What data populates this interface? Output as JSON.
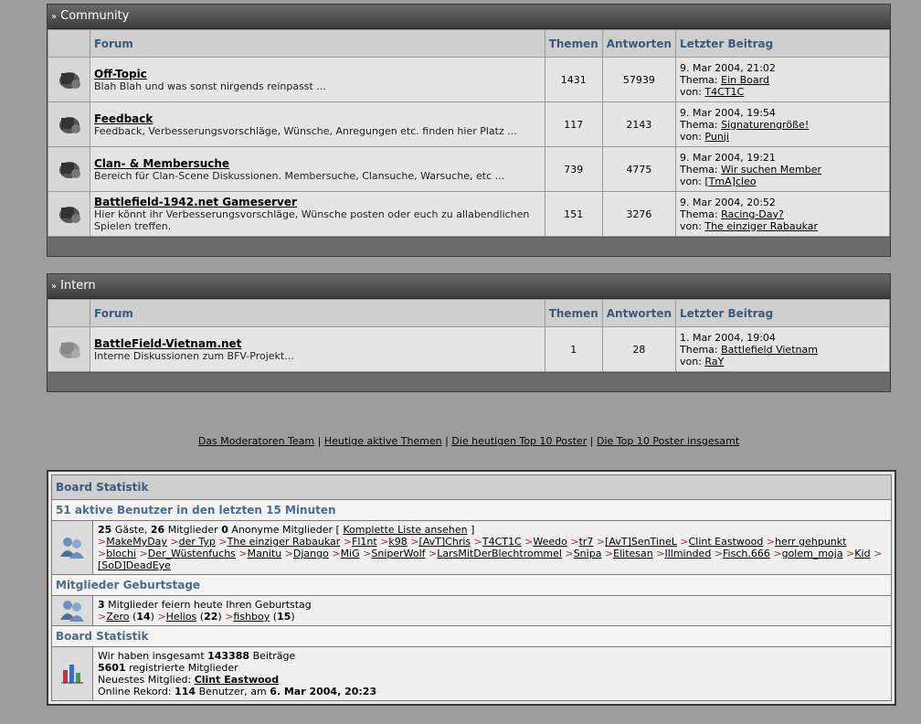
{
  "categories": [
    {
      "title": "Community",
      "headers": {
        "forum": "Forum",
        "topics": "Themen",
        "replies": "Antworten",
        "last": "Letzter Beitrag"
      },
      "forums": [
        {
          "name": "Off-Topic",
          "desc": "Blah Blah und was sonst nirgends reinpasst ...",
          "topics": "1431",
          "replies": "57939",
          "date": "9. Mar 2004, 21:02",
          "thema_prefix": "Thema:",
          "thema": "Ein Board",
          "von_prefix": "von:",
          "von": "T4CT1C"
        },
        {
          "name": "Feedback",
          "desc": "Feedback, Verbesserungsvorschläge, Wünsche, Anregungen etc. finden hier Platz ...",
          "topics": "117",
          "replies": "2143",
          "date": "9. Mar 2004, 19:54",
          "thema_prefix": "Thema:",
          "thema": "Signaturengröße!",
          "von_prefix": "von:",
          "von": "Punji"
        },
        {
          "name": "Clan- & Membersuche",
          "desc": "Bereich für Clan-Scene Diskussionen. Membersuche, Clansuche, Warsuche, etc ...",
          "topics": "739",
          "replies": "4775",
          "date": "9. Mar 2004, 19:21",
          "thema_prefix": "Thema:",
          "thema": "Wir suchen Member",
          "von_prefix": "von:",
          "von": "[TmA]cleo"
        },
        {
          "name": "Battlefield-1942.net Gameserver",
          "desc": "Hier könnt ihr Verbesserungsvorschläge, Wünsche posten oder euch zu allabendlichen Spielen treffen.",
          "topics": "151",
          "replies": "3276",
          "date": "9. Mar 2004, 20:52",
          "thema_prefix": "Thema:",
          "thema": "Racing-Day?",
          "von_prefix": "von:",
          "von": "The einziger Rabaukar"
        }
      ]
    },
    {
      "title": "Intern",
      "headers": {
        "forum": "Forum",
        "topics": "Themen",
        "replies": "Antworten",
        "last": "Letzter Beitrag"
      },
      "forums": [
        {
          "name": "BattleField-Vietnam.net",
          "desc": "Interne Diskussionen zum BFV-Projekt...",
          "topics": "1",
          "replies": "28",
          "date": "1. Mar 2004, 19:04",
          "thema_prefix": "Thema:",
          "thema": "Battlefield Vietnam",
          "von_prefix": "von:",
          "von": "RaY"
        }
      ]
    }
  ],
  "links": [
    "Das Moderatoren Team",
    "Heutige aktive Themen",
    "Die heutigen Top 10 Poster",
    "Die Top 10 Poster insgesamt"
  ],
  "stats": {
    "title": "Board Statistik",
    "active_title": "51 aktive Benutzer in den letzten 15 Minuten",
    "guests": "25",
    "guests_label": "Gäste,",
    "members": "26",
    "members_label": "Mitglieder",
    "anon": "0",
    "anon_label": "Anonyme Mitglieder [",
    "full_list": "Komplette Liste ansehen",
    "full_list_close": "]",
    "users": [
      "MakeMyDay",
      "der Typ",
      "The einziger Rabaukar",
      "Fl1nt",
      "k98",
      "[AvT]Chris",
      "T4CT1C",
      "Weedo",
      "tr7",
      "[AvT]SenTineL",
      "Clint Eastwood",
      "herr gehpunkt",
      "blochi",
      "Der_Wüstenfuchs",
      "Manitu",
      "Django",
      "MiG",
      "SniperWolf",
      "LarsMitDerBlechtrommel",
      "Snipa",
      "Elitesan",
      "Illminded",
      "Fisch.666",
      "golem_moja",
      "Kid",
      "[SoD]DeadEye"
    ],
    "birthday_title": "Mitglieder Geburtstage",
    "birthday_count": "3",
    "birthday_text": "Mitglieder feiern heute Ihren Geburtstag",
    "birthdays": [
      {
        "name": "Zero",
        "age": "14"
      },
      {
        "name": "Helios",
        "age": "22"
      },
      {
        "name": "fishboy",
        "age": "15"
      }
    ],
    "board_title": "Board Statistik",
    "posts_pre": "Wir haben insgesamt",
    "posts": "143388",
    "posts_post": "Beiträge",
    "registered": "5601",
    "registered_label": "registrierte Mitglieder",
    "newest_label": "Neuestes Mitglied:",
    "newest": "Clint Eastwood",
    "record_label": "Online Rekord:",
    "record_count": "114",
    "record_mid": "Benutzer, am",
    "record_date": "6. Mar 2004, 20:23"
  }
}
